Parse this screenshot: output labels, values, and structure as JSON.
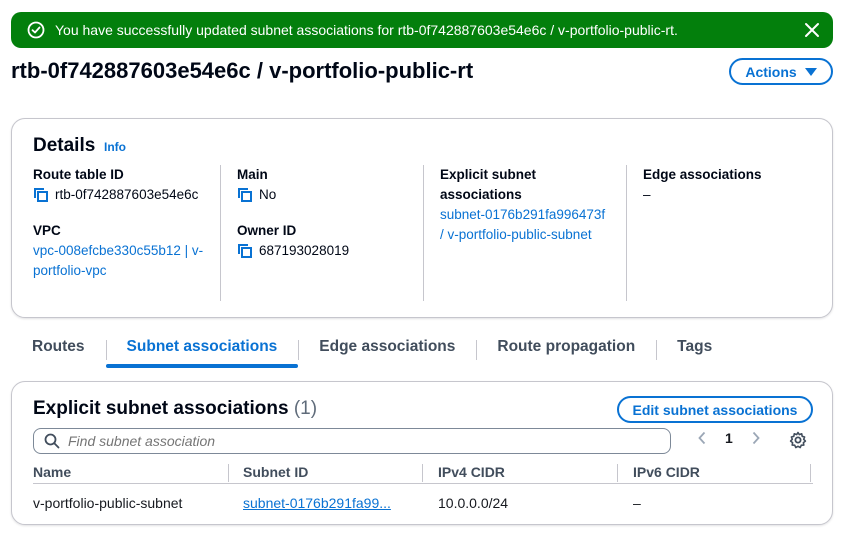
{
  "flash": {
    "message": "You have successfully updated subnet associations for rtb-0f742887603e54e6c / v-portfolio-public-rt.",
    "status_color": "#037f0c"
  },
  "header": {
    "title": "rtb-0f742887603e54e6c / v-portfolio-public-rt",
    "actions_label": "Actions"
  },
  "details": {
    "title": "Details",
    "info_label": "Info",
    "route_table_id_label": "Route table ID",
    "route_table_id_value": "rtb-0f742887603e54e6c",
    "vpc_label": "VPC",
    "vpc_value": "vpc-008efcbe330c55b12 | v-portfolio-vpc",
    "main_label": "Main",
    "main_value": "No",
    "owner_id_label": "Owner ID",
    "owner_id_value": "687193028019",
    "explicit_subnet_label": "Explicit subnet associations",
    "explicit_subnet_value": "subnet-0176b291fa996473f / v-portfolio-public-subnet",
    "edge_assoc_label": "Edge associations",
    "edge_assoc_value": "–"
  },
  "tabs": [
    {
      "label": "Routes",
      "active": false
    },
    {
      "label": "Subnet associations",
      "active": true
    },
    {
      "label": "Edge associations",
      "active": false
    },
    {
      "label": "Route propagation",
      "active": false
    },
    {
      "label": "Tags",
      "active": false
    }
  ],
  "assoc_table": {
    "title": "Explicit subnet associations",
    "count": "(1)",
    "edit_label": "Edit subnet associations",
    "search_placeholder": "Find subnet association",
    "page": "1",
    "columns": [
      "Name",
      "Subnet ID",
      "IPv4 CIDR",
      "IPv6 CIDR"
    ],
    "rows": [
      {
        "name": "v-portfolio-public-subnet",
        "subnet_id": "subnet-0176b291fa99...",
        "ipv4": "10.0.0.0/24",
        "ipv6": "–"
      }
    ]
  },
  "colors": {
    "accent": "#0972d3",
    "success": "#037f0c",
    "text": "#000716"
  }
}
